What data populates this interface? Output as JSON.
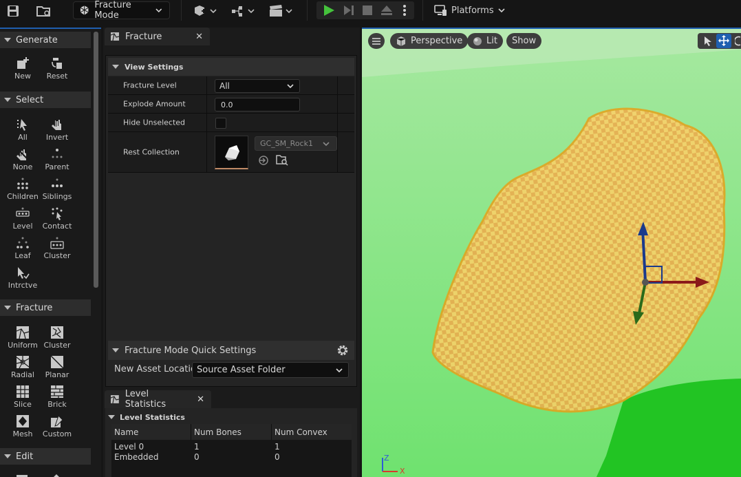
{
  "toolbar": {
    "mode_label": "Fracture Mode",
    "platforms_label": "Platforms"
  },
  "palette": {
    "sections": {
      "generate": "Generate",
      "select": "Select",
      "fracture": "Fracture",
      "edit": "Edit"
    },
    "generate_tools": [
      "New",
      "Reset"
    ],
    "select_tools": [
      "All",
      "Invert",
      "None",
      "Parent",
      "Children",
      "Siblings",
      "Level",
      "Contact",
      "Leaf",
      "Cluster",
      "Intrctve"
    ],
    "fracture_tools": [
      "Uniform",
      "Cluster",
      "Radial",
      "Planar",
      "Slice",
      "Brick",
      "Mesh",
      "Custom"
    ]
  },
  "fracture_panel": {
    "tab_label": "Fracture",
    "view_settings_label": "View Settings",
    "fracture_level_label": "Fracture Level",
    "fracture_level_value": "All",
    "explode_amount_label": "Explode Amount",
    "explode_amount_value": "0.0",
    "hide_unselected_label": "Hide Unselected",
    "hide_unselected_checked": false,
    "rest_collection_label": "Rest Collection",
    "rest_collection_value": "GC_SM_Rock1",
    "quick_settings_label": "Fracture Mode Quick Settings",
    "new_asset_location_label": "New Asset Location",
    "new_asset_location_value": "Source Asset Folder"
  },
  "level_stats": {
    "tab_label": "Level Statistics",
    "section_label": "Level Statistics",
    "columns": [
      "Name",
      "Num Bones",
      "Num Convex"
    ],
    "rows": [
      [
        "Level 0",
        "1",
        "1"
      ],
      [
        "Embedded",
        "0",
        "0"
      ]
    ]
  },
  "viewport": {
    "menu_icon": "hamburger-icon",
    "perspective_label": "Perspective",
    "lit_label": "Lit",
    "show_label": "Show",
    "axis_z": "Z",
    "axis_x": "X",
    "colors": {
      "ground": "#6fe26f",
      "selection": "#ffc34a",
      "outline": "#e6a11a"
    }
  }
}
